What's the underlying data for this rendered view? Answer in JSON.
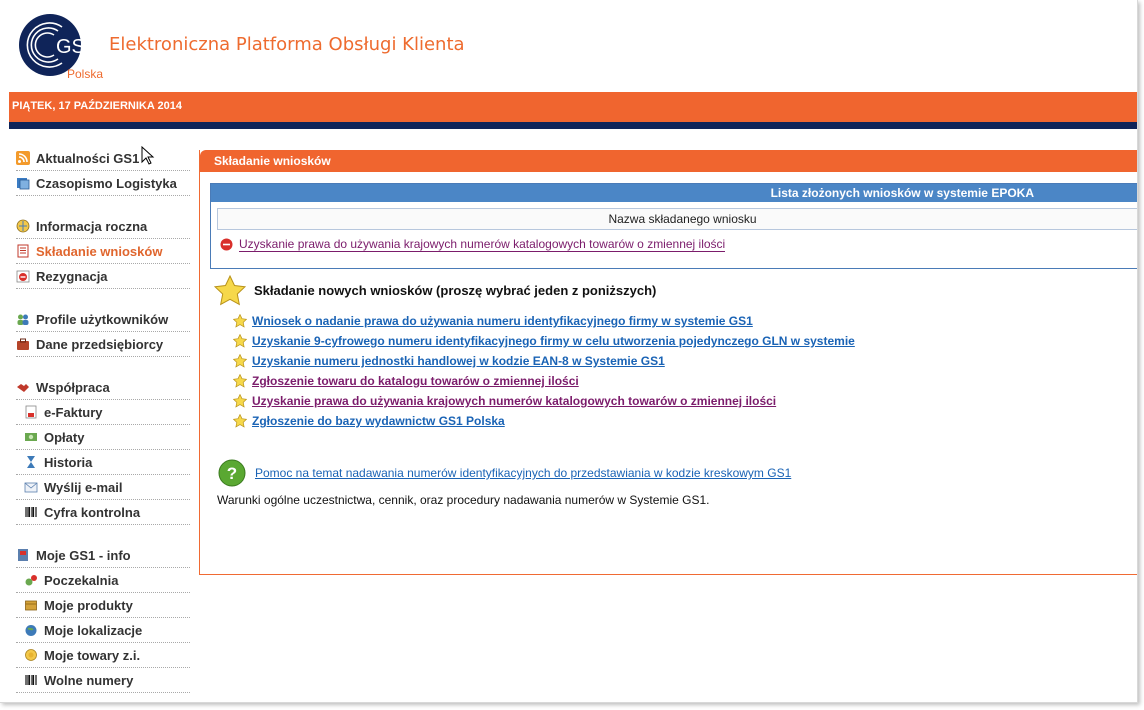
{
  "header": {
    "logo_mark": "GS1",
    "title": "Elektroniczna Platforma Obsługi Klienta",
    "subtitle": "Polska",
    "brand_color": "#f0652f",
    "navy_color": "#0f2459"
  },
  "datebar": {
    "text": "PIĄTEK, 17 PAŹDZIERNIKA 2014"
  },
  "sidebar": {
    "items": [
      {
        "label": "Aktualności GS1",
        "icon": "rss-icon"
      },
      {
        "label": "Czasopismo Logistyka",
        "icon": "magazine-icon"
      },
      {
        "label": "Informacja roczna",
        "icon": "globe-info-icon"
      },
      {
        "label": "Składanie wniosków",
        "icon": "document-icon",
        "active": true
      },
      {
        "label": "Rezygnacja",
        "icon": "stop-icon"
      },
      {
        "label": "Profile użytkowników",
        "icon": "users-icon"
      },
      {
        "label": "Dane przedsiębiorcy",
        "icon": "briefcase-icon"
      },
      {
        "label": "Współpraca",
        "icon": "handshake-icon"
      },
      {
        "label": "e-Faktury",
        "icon": "invoice-icon"
      },
      {
        "label": "Opłaty",
        "icon": "money-icon"
      },
      {
        "label": "Historia",
        "icon": "hourglass-icon"
      },
      {
        "label": "Wyślij e-mail",
        "icon": "email-icon"
      },
      {
        "label": "Cyfra kontrolna",
        "icon": "barcode-icon"
      },
      {
        "label": "Moje GS1 - info",
        "icon": "book-icon"
      },
      {
        "label": "Poczekalnia",
        "icon": "gears-icon"
      },
      {
        "label": "Moje produkty",
        "icon": "box-icon"
      },
      {
        "label": "Moje lokalizacje",
        "icon": "globe-icon"
      },
      {
        "label": "Moje towary z.i.",
        "icon": "coins-icon"
      },
      {
        "label": "Wolne numery",
        "icon": "barcode-icon"
      }
    ]
  },
  "main": {
    "title": "Składanie wniosków",
    "list_box_title": "Lista złożonych wniosków w systemie EPOKA",
    "column_header": "Nazwa składanego wniosku",
    "submitted": [
      {
        "label": "Uzyskanie prawa do używania krajowych numerów katalogowych towarów o zmiennej ilości"
      }
    ],
    "new_title": "Składanie nowych wniosków (proszę wybrać jeden z poniższych)",
    "new_links": [
      {
        "label": "Wniosek o nadanie prawa do używania numeru identyfikacyjnego firmy w systemie GS1",
        "visited": false
      },
      {
        "label": "Uzyskanie 9-cyfrowego numeru identyfikacyjnego firmy w celu utworzenia pojedynczego GLN w systemie",
        "visited": false
      },
      {
        "label": "Uzyskanie numeru jednostki handlowej w kodzie EAN-8 w Systemie GS1",
        "visited": false
      },
      {
        "label": "Zgłoszenie towaru do katalogu towarów o zmiennej ilości",
        "visited": true
      },
      {
        "label": "Uzyskanie prawa do używania krajowych numerów katalogowych towarów o zmiennej ilości",
        "visited": true
      },
      {
        "label": "Zgłoszenie do bazy wydawnictw GS1 Polska",
        "visited": false
      }
    ],
    "help_link": "Pomoc na temat nadawania numerów identyfikacyjnych do przedstawiania w kodzie kreskowym GS1",
    "terms_text": "Warunki ogólne uczestnictwa, cennik, oraz procedury nadawania numerów w Systemie GS1."
  }
}
